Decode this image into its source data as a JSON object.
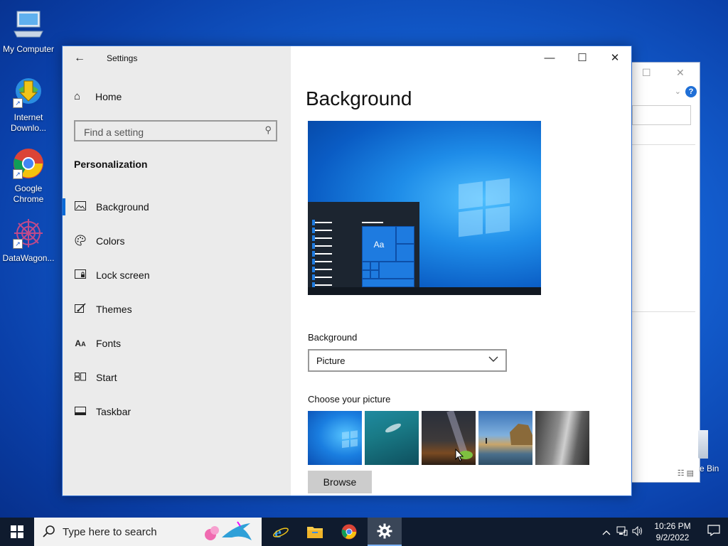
{
  "desktop": {
    "icons": [
      {
        "label": "My Computer"
      },
      {
        "label": "Internet Downlo..."
      },
      {
        "label": "Google Chrome"
      },
      {
        "label": "DataWagon..."
      }
    ],
    "recycle_bin_label": "e Bin"
  },
  "settings": {
    "title": "Settings",
    "home_label": "Home",
    "search_placeholder": "Find a setting",
    "section": "Personalization",
    "nav": [
      {
        "label": "Background",
        "icon": "picture-icon",
        "active": true
      },
      {
        "label": "Colors",
        "icon": "palette-icon"
      },
      {
        "label": "Lock screen",
        "icon": "lock-screen-icon"
      },
      {
        "label": "Themes",
        "icon": "themes-icon"
      },
      {
        "label": "Fonts",
        "icon": "fonts-icon"
      },
      {
        "label": "Start",
        "icon": "start-icon"
      },
      {
        "label": "Taskbar",
        "icon": "taskbar-icon"
      }
    ],
    "page_title": "Background",
    "preview_sample_text": "Aa",
    "background_label": "Background",
    "background_value": "Picture",
    "choose_picture_label": "Choose your picture",
    "browse_label": "Browse",
    "accent": "#0b6ad6"
  },
  "taskbar": {
    "search_placeholder": "Type here to search",
    "time": "10:26 PM",
    "date": "9/2/2022"
  }
}
